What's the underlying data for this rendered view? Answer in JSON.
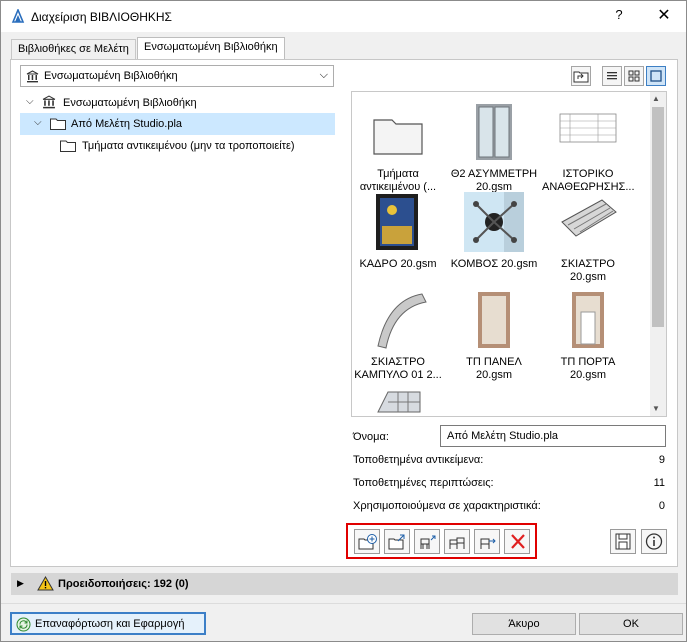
{
  "window": {
    "title": "Διαχείριση ΒΙΒΛΙΟΘΗΚΗΣ",
    "help_glyph": "?",
    "close_glyph": "✕"
  },
  "tabs": [
    {
      "label": "Βιβλιοθήκες σε Μελέτη",
      "active": false
    },
    {
      "label": "Ενσωματωμένη Βιβλιοθήκη",
      "active": true
    }
  ],
  "library_select": {
    "value": "Ενσωματωμένη Βιβλιοθήκη"
  },
  "tree": [
    {
      "label": "Ενσωματωμένη Βιβλιοθήκη",
      "icon": "library-icon",
      "expanded": true,
      "selected": false
    },
    {
      "label": "Από Μελέτη Studio.pla",
      "icon": "folder-icon",
      "expanded": true,
      "selected": true
    },
    {
      "label": "Τμήματα αντικειμένου (μην τα τροποποιείτε)",
      "icon": "folder-icon",
      "expanded": false,
      "selected": false
    }
  ],
  "view_buttons": [
    "folder-up-icon",
    "list-view-icon",
    "small-icons-view-icon",
    "large-icons-view-icon"
  ],
  "grid_items": [
    {
      "caption": "Τμήματα αντικειμένου (...",
      "thumb": "folder"
    },
    {
      "caption": "Θ2 ΑΣΥΜΜΕΤΡΗ 20.gsm",
      "thumb": "door-double"
    },
    {
      "caption": "ΙΣΤΟΡΙΚΟ ΑΝΑΘΕΩΡΗΣΗΣ...",
      "thumb": "revision-table"
    },
    {
      "caption": "ΚΑΔΡΟ 20.gsm",
      "thumb": "picture-frame"
    },
    {
      "caption": "ΚΟΜΒΟΣ 20.gsm",
      "thumb": "node"
    },
    {
      "caption": "ΣΚΙΑΣΤΡΟ 20.gsm",
      "thumb": "shade"
    },
    {
      "caption": "ΣΚΙΑΣΤΡΟ ΚΑΜΠΥΛΟ 01 2...",
      "thumb": "curved-shade"
    },
    {
      "caption": "ΤΠ ΠΑΝΕΛ 20.gsm",
      "thumb": "panel"
    },
    {
      "caption": "ΤΠ ΠΟΡΤΑ 20.gsm",
      "thumb": "panel-door"
    },
    {
      "caption": "",
      "thumb": "partial-shade"
    }
  ],
  "properties": {
    "name_label": "Όνομα:",
    "name_value": "Από Μελέτη Studio.pla",
    "rows": [
      {
        "label": "Τοποθετημένα αντικείμενα:",
        "value": "9"
      },
      {
        "label": "Τοποθετημένες περιπτώσεις:",
        "value": "11"
      },
      {
        "label": "Χρησιμοποιούμενα σε χαρακτηριστικά:",
        "value": "0"
      }
    ]
  },
  "actions": [
    "new-folder-icon",
    "import-folder-icon",
    "add-object-icon",
    "add-objects-icon",
    "move-object-icon",
    "delete-icon"
  ],
  "side_actions": [
    "save-icon",
    "info-icon"
  ],
  "warnings": {
    "label": "Προειδοποιήσεις: 192 (0)"
  },
  "footer": {
    "reload_label": "Επαναφόρτωση και Εφαρμογή",
    "cancel_label": "Άκυρο",
    "ok_label": "ΟΚ"
  },
  "colors": {
    "selection": "#cce8ff",
    "accent": "#3c7fc7",
    "highlight_border": "#e00000"
  }
}
